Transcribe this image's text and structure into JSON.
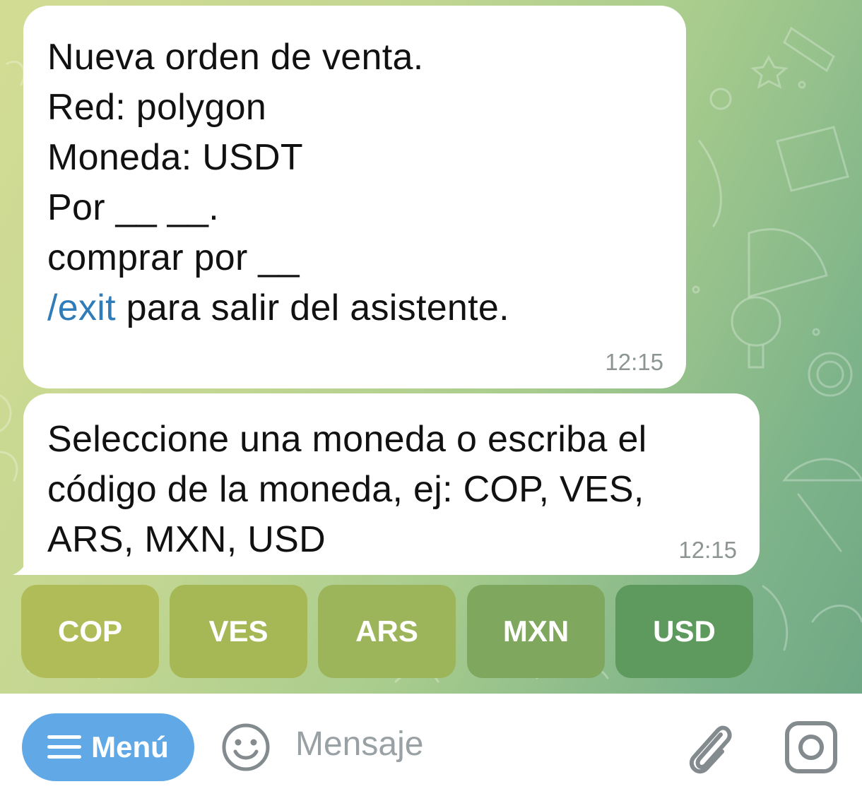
{
  "messages": [
    {
      "lines": [
        "Nueva orden de venta.",
        "Red: polygon",
        "Moneda: USDT",
        "Por __ __.",
        "comprar por __",
        ""
      ],
      "command": "/exit",
      "command_suffix": " para salir del asistente.",
      "time": "12:15"
    },
    {
      "lines": [
        "Seleccione una moneda o escriba el",
        "código de la moneda, ej: COP, VES,",
        "ARS, MXN, USD"
      ],
      "time": "12:15"
    }
  ],
  "keyboard": [
    "COP",
    "VES",
    "ARS",
    "MXN",
    "USD"
  ],
  "input_bar": {
    "menu_label": "Menú",
    "placeholder": "Mensaje"
  },
  "colors": {
    "link": "#2f7cb8",
    "menu_button": "#61a9e6",
    "bubble": "#ffffff"
  }
}
